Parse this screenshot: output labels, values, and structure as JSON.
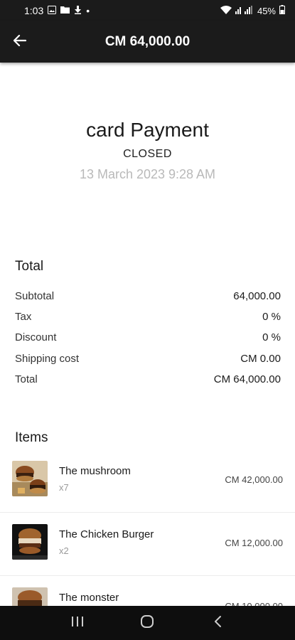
{
  "status_bar": {
    "time": "1:03",
    "dot": "•",
    "battery": "45%"
  },
  "app_bar": {
    "title": "CM 64,000.00"
  },
  "payment": {
    "title": "card Payment",
    "status": "CLOSED",
    "date": "13 March 2023 9:28 AM"
  },
  "totals": {
    "heading": "Total",
    "rows": [
      {
        "label": "Subtotal",
        "value": "64,000.00"
      },
      {
        "label": "Tax",
        "value": "0 %"
      },
      {
        "label": "Discount",
        "value": "0 %"
      },
      {
        "label": "Shipping cost",
        "value": "CM 0.00"
      },
      {
        "label": "Total",
        "value": "CM 64,000.00"
      }
    ]
  },
  "items": {
    "heading": "Items",
    "list": [
      {
        "name": "The mushroom",
        "qty": "x7",
        "price": "CM 42,000.00"
      },
      {
        "name": "The Chicken Burger",
        "qty": "x2",
        "price": "CM 12,000.00"
      },
      {
        "name": "The monster",
        "qty": "",
        "price": "CM 10,000.00"
      }
    ]
  },
  "colors": {
    "bar_bg": "#1b1b1b",
    "nav_bg": "#0e0e0e",
    "date_gray": "#b9b9b9"
  }
}
